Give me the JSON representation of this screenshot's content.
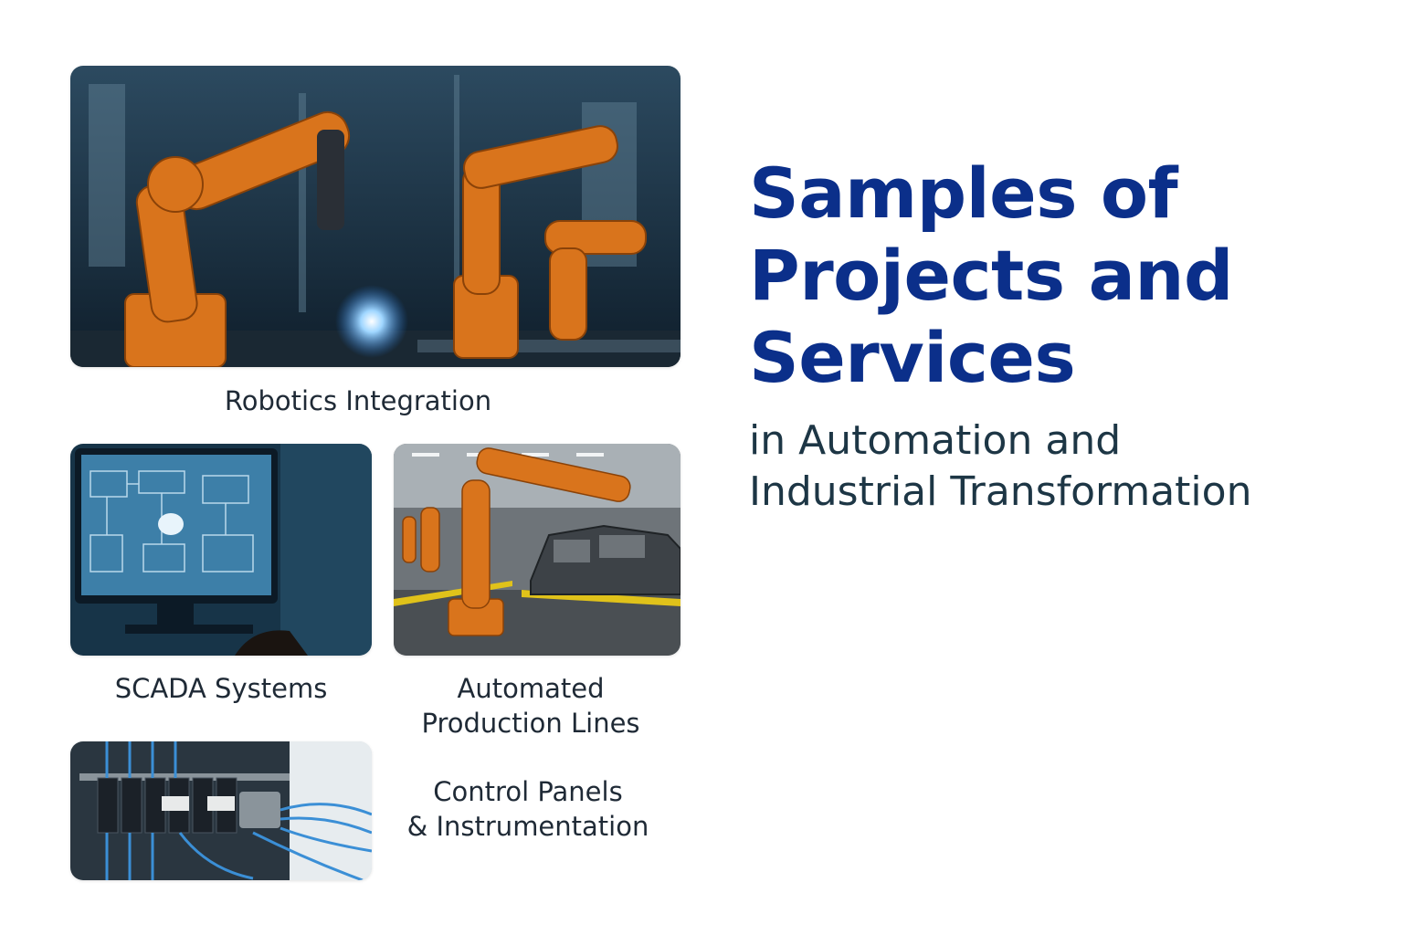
{
  "heading": {
    "title": "Samples of\nProjects and\nServices",
    "subtitle": "in Automation and\nIndustrial Transformation"
  },
  "projects": [
    {
      "caption": "Robotics Integration",
      "image": "welding-robots-photo"
    },
    {
      "caption": "SCADA Systems",
      "image": "scada-monitor-photo"
    },
    {
      "caption": "Automated\nProduction Lines",
      "image": "car-assembly-line-photo"
    },
    {
      "caption": "Control Panels\n& Instrumentation",
      "image": "control-panel-wiring-photo"
    }
  ],
  "colors": {
    "title": "#0b2f8a",
    "subtitle": "#1d3645",
    "robot_orange": "#d9741c",
    "cable_blue": "#3b8fd6"
  }
}
